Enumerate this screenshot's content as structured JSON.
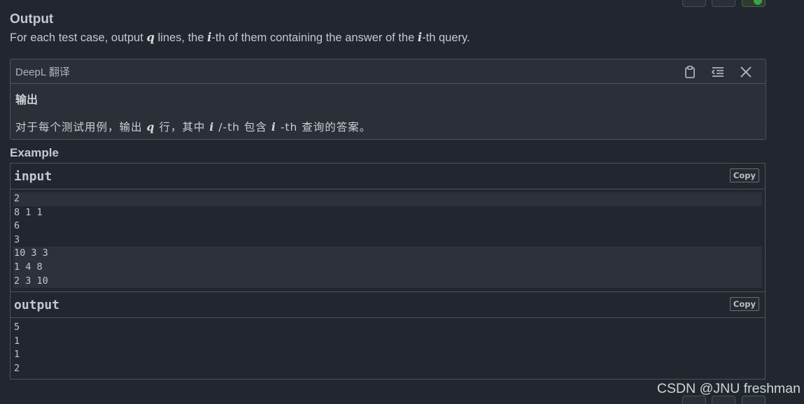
{
  "section": {
    "title": "Output",
    "text_part1": "For each test case, output ",
    "var_q": "q",
    "text_part2": " lines, the ",
    "var_i": "i",
    "text_part3": "-th of them containing the answer of the ",
    "text_part4": "-th query."
  },
  "deepl": {
    "header": "DeepL 翻译",
    "body_title": "输出",
    "body_text_part1": "对于每个测试用例，输出",
    "var_q": "q",
    "body_text_part2": "行，其中",
    "var_i": "i",
    "body_text_part3": "/-th 包含",
    "body_text_part4": "-th 查询的答案。",
    "icons": [
      "clipboard-icon",
      "indent-icon",
      "close-icon"
    ]
  },
  "example": {
    "title": "Example",
    "input": {
      "label": "input",
      "copy_label": "Copy",
      "lines": [
        {
          "text": "2",
          "highlight": true
        },
        {
          "text": "8 1 1",
          "highlight": false
        },
        {
          "text": "6",
          "highlight": false
        },
        {
          "text": "3",
          "highlight": false
        },
        {
          "text": "10 3 3",
          "highlight": true
        },
        {
          "text": "1 4 8",
          "highlight": true
        },
        {
          "text": "2 3 10",
          "highlight": true
        }
      ]
    },
    "output": {
      "label": "output",
      "copy_label": "Copy",
      "lines": [
        {
          "text": "5"
        },
        {
          "text": "1"
        },
        {
          "text": "1"
        },
        {
          "text": "2"
        }
      ]
    }
  },
  "watermark": "CSDN @JNU freshman",
  "colors": {
    "background": "#22262e",
    "panel": "#2b2f37",
    "border": "#4d535c",
    "text": "#c3c8d0",
    "accent_green": "#3aa246"
  }
}
